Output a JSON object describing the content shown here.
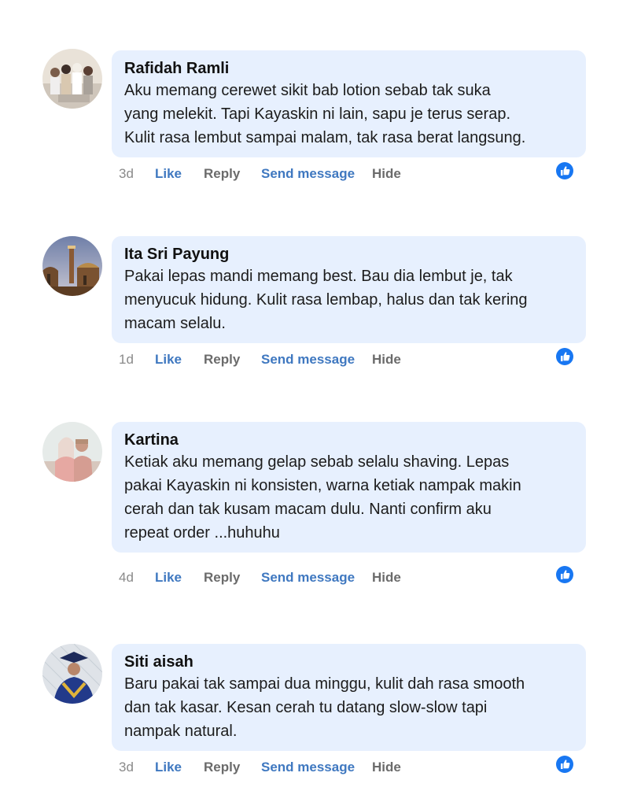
{
  "comments": [
    {
      "author": "Rafidah Ramli",
      "lines": [
        "Aku memang cerewet sikit bab lotion sebab tak suka",
        "yang melekit. Tapi Kayaskin ni lain, sapu je terus serap.",
        "Kulit rasa lembut sampai malam, tak rasa berat langsung."
      ],
      "time": "3d",
      "like": "Like",
      "reply": "Reply",
      "send": "Send message",
      "hide": "Hide"
    },
    {
      "author": "Ita Sri Payung",
      "lines": [
        "Pakai lepas mandi memang best. Bau dia lembut je, tak",
        "menyucuk hidung. Kulit rasa lembap, halus dan tak kering",
        "macam selalu."
      ],
      "time": "1d",
      "like": "Like",
      "reply": "Reply",
      "send": "Send message",
      "hide": "Hide"
    },
    {
      "author": "Kartina",
      "lines": [
        "Ketiak aku memang gelap sebab selalu shaving. Lepas",
        "pakai Kayaskin ni konsisten, warna ketiak nampak makin",
        "cerah dan tak kusam macam dulu. Nanti confirm aku",
        "repeat order ...huhuhu"
      ],
      "time": "4d",
      "like": "Like",
      "reply": "Reply",
      "send": "Send message",
      "hide": "Hide"
    },
    {
      "author": "Siti aisah",
      "lines": [
        "Baru pakai tak sampai dua minggu, kulit dah rasa smooth",
        "dan tak kasar. Kesan cerah tu datang slow-slow tapi",
        "nampak natural."
      ],
      "time": "3d",
      "like": "Like",
      "reply": "Reply",
      "send": "Send message",
      "hide": "Hide"
    }
  ],
  "colors": {
    "bubble": "#e7f0fe",
    "link": "#3f78c0",
    "muted": "#6b6b6b",
    "like_icon": "#1877f2"
  },
  "icons": {
    "like_reaction": "thumbs-up-icon"
  }
}
